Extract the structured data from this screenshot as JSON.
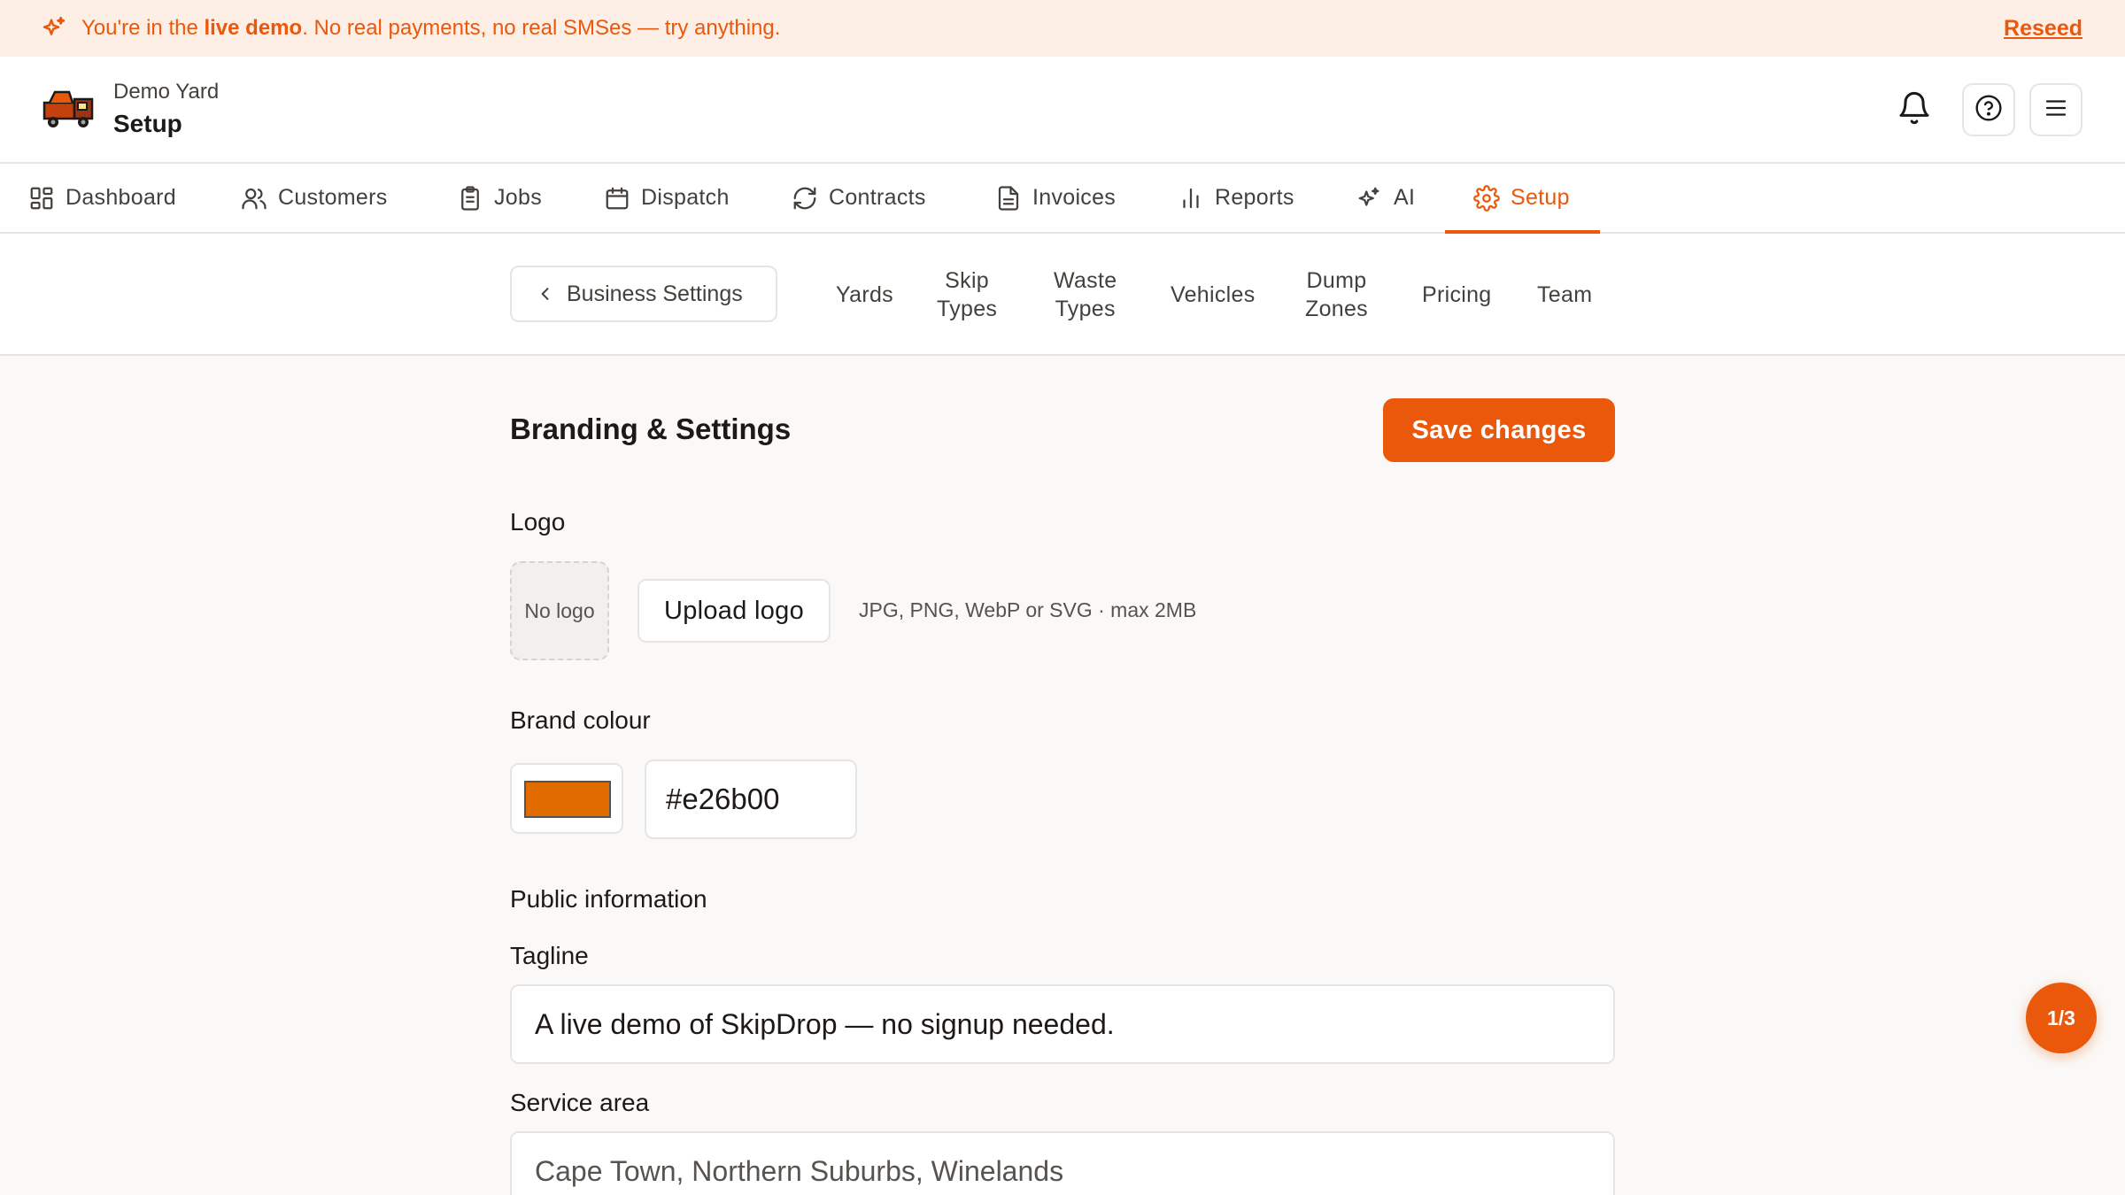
{
  "banner": {
    "prefix": "You're in the ",
    "highlight": "live demo",
    "suffix": ". No real payments, no real SMSes — try anything.",
    "reseed_label": "Reseed"
  },
  "header": {
    "yard_name": "Demo Yard",
    "page_title": "Setup"
  },
  "nav": {
    "items": [
      {
        "label": "Dashboard",
        "icon": "dashboard-icon"
      },
      {
        "label": "Customers",
        "icon": "users-icon"
      },
      {
        "label": "Jobs",
        "icon": "clipboard-icon"
      },
      {
        "label": "Dispatch",
        "icon": "calendar-icon"
      },
      {
        "label": "Contracts",
        "icon": "refresh-icon"
      },
      {
        "label": "Invoices",
        "icon": "file-icon"
      },
      {
        "label": "Reports",
        "icon": "bar-chart-icon"
      },
      {
        "label": "AI",
        "icon": "sparkles-icon"
      },
      {
        "label": "Setup",
        "icon": "gear-icon",
        "active": true
      }
    ]
  },
  "subnav": {
    "back_label": "Business Settings",
    "items": [
      {
        "line1": "Yards",
        "line2": ""
      },
      {
        "line1": "Skip",
        "line2": "Types"
      },
      {
        "line1": "Waste",
        "line2": "Types"
      },
      {
        "line1": "Vehicles",
        "line2": ""
      },
      {
        "line1": "Dump",
        "line2": "Zones"
      },
      {
        "line1": "Pricing",
        "line2": ""
      },
      {
        "line1": "Team",
        "line2": ""
      }
    ]
  },
  "content": {
    "title": "Branding & Settings",
    "save_label": "Save changes",
    "logo_label": "Logo",
    "logo_placeholder": "No logo",
    "upload_label": "Upload logo",
    "upload_hint": "JPG, PNG, WebP or SVG · max 2MB",
    "brand_colour_label": "Brand colour",
    "brand_colour_value": "#e26b00",
    "public_info_label": "Public information",
    "tagline_label": "Tagline",
    "tagline_value": "A live demo of SkipDrop — no signup needed.",
    "service_area_label": "Service area",
    "service_area_placeholder": "Cape Town, Northern Suburbs, Winelands"
  },
  "pager": {
    "label": "1/3"
  },
  "colors": {
    "accent": "#ea580c",
    "banner_bg": "#fdeee6",
    "brand": "#e26b00"
  }
}
